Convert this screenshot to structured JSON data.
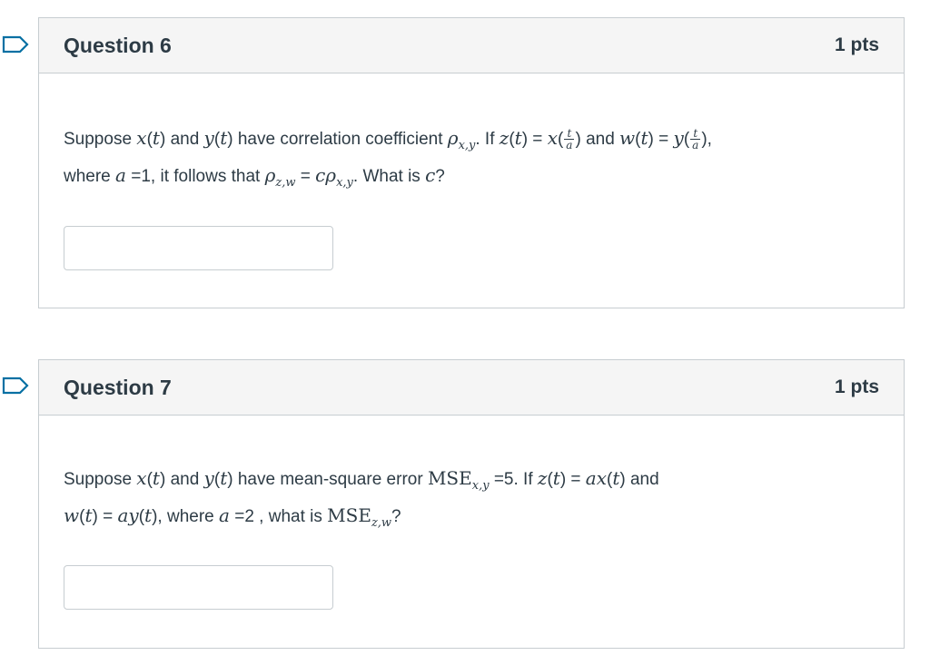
{
  "questions": [
    {
      "title": "Question 6",
      "points": "1 pts",
      "text": {
        "w1": "Suppose",
        "w2": "and",
        "w3": "have correlation coefficient",
        "w4": ". If",
        "w5": "and",
        "w6": ",",
        "w7": "where",
        "w8": "=1, it follows that",
        "w9": ". What is",
        "w10": "?"
      },
      "answer_value": ""
    },
    {
      "title": "Question 7",
      "points": "1 pts",
      "text": {
        "w1": "Suppose",
        "w2": "and",
        "w3": "have mean-square error",
        "w4": "=5. If",
        "w5": "and",
        "w6": ", where",
        "w7": "=2 , what is",
        "w8": "?"
      },
      "answer_value": ""
    }
  ]
}
